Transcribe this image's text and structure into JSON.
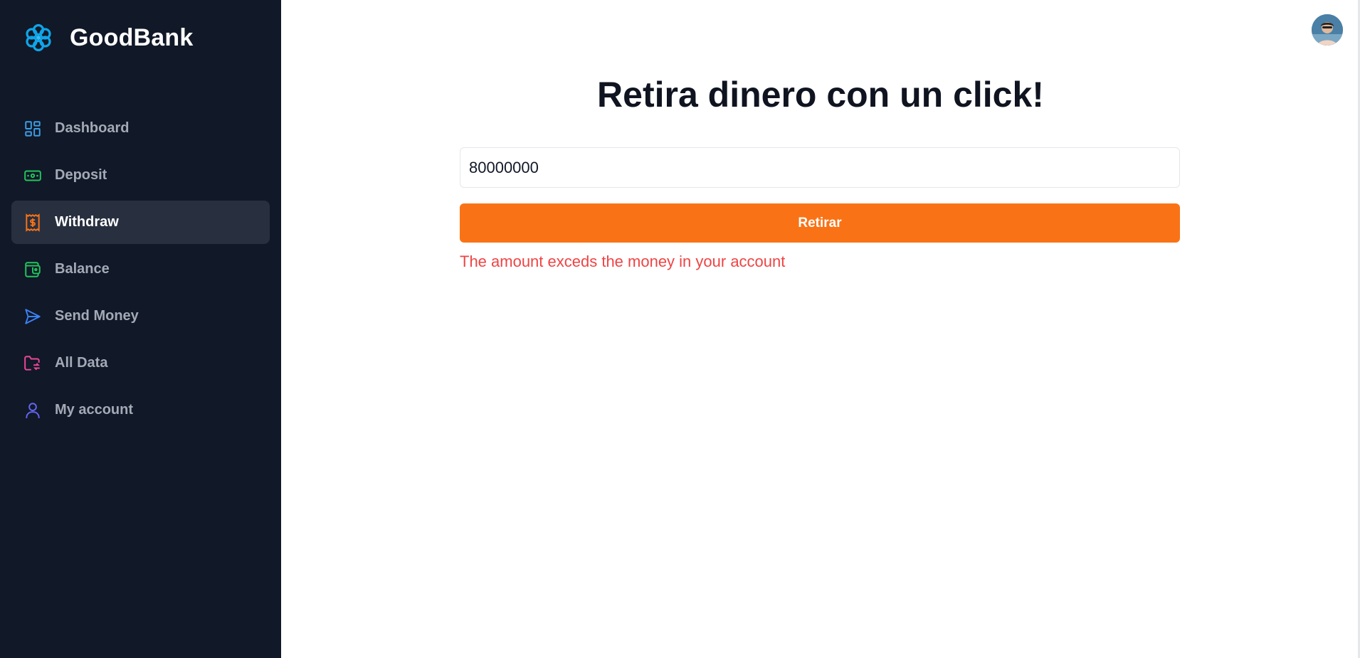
{
  "brand": {
    "name": "GoodBank",
    "logo_icon": "flower-logo-icon"
  },
  "sidebar": {
    "items": [
      {
        "label": "Dashboard",
        "icon": "dashboard-grid-icon",
        "color": "#3b9ee6",
        "active": false
      },
      {
        "label": "Deposit",
        "icon": "banknote-icon",
        "color": "#22c55e",
        "active": false
      },
      {
        "label": "Withdraw",
        "icon": "receipt-dollar-icon",
        "color": "#f97316",
        "active": true
      },
      {
        "label": "Balance",
        "icon": "wallet-icon",
        "color": "#22c55e",
        "active": false
      },
      {
        "label": "Send Money",
        "icon": "paper-plane-icon",
        "color": "#3b82f6",
        "active": false
      },
      {
        "label": "All Data",
        "icon": "folder-sync-icon",
        "color": "#ec4899",
        "active": false
      },
      {
        "label": "My account",
        "icon": "user-icon",
        "color": "#6366f1",
        "active": false
      }
    ]
  },
  "main": {
    "title": "Retira dinero con un click!",
    "amount_value": "80000000",
    "submit_label": "Retirar",
    "error": "The amount exceds the money in your account"
  },
  "colors": {
    "sidebar_bg": "#111827",
    "accent": "#f97316",
    "error": "#ef4444"
  }
}
